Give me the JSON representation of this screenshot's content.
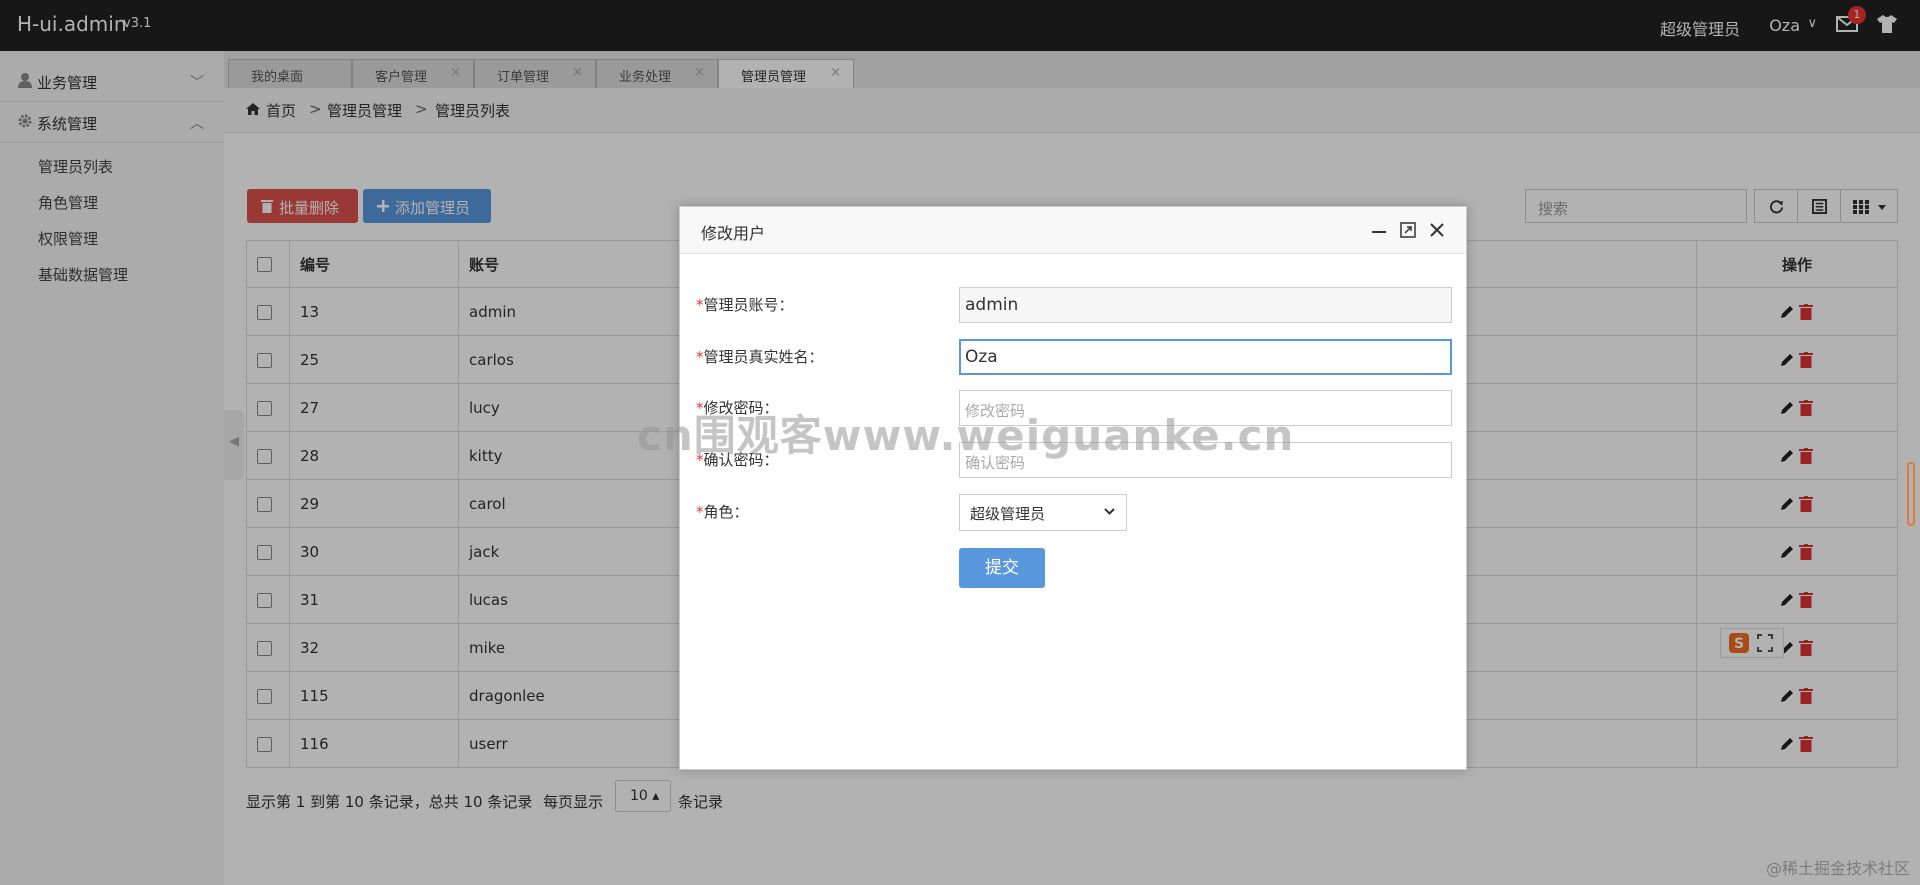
{
  "app": {
    "title": "H-ui.admin",
    "version": "v3.1"
  },
  "header": {
    "role": "超级管理员",
    "user": "Oza",
    "chevron": "∨",
    "mail_badge": "1",
    "icons": [
      "mail-icon",
      "shirt-icon"
    ]
  },
  "sidebar": {
    "groups": [
      {
        "label": "业务管理",
        "icon": "user-icon",
        "expanded": false
      },
      {
        "label": "系统管理",
        "icon": "gear-icon",
        "expanded": true
      }
    ],
    "items": [
      "管理员列表",
      "角色管理",
      "权限管理",
      "基础数据管理"
    ]
  },
  "tabs": [
    {
      "label": "我的桌面",
      "closable": false
    },
    {
      "label": "客户管理",
      "closable": true
    },
    {
      "label": "订单管理",
      "closable": true
    },
    {
      "label": "业务处理",
      "closable": true
    },
    {
      "label": "管理员管理",
      "closable": true,
      "active": true
    }
  ],
  "breadcrumb": [
    "首页",
    "管理员管理",
    "管理员列表"
  ],
  "breadcrumb_sep": ">",
  "toolbar": {
    "batch_delete": "批量删除",
    "add_admin": "添加管理员",
    "search_placeholder": "搜索"
  },
  "table": {
    "headers": {
      "id": "编号",
      "account": "账号",
      "actions": "操作"
    },
    "rows": [
      {
        "id": "13",
        "account": "admin"
      },
      {
        "id": "25",
        "account": "carlos"
      },
      {
        "id": "27",
        "account": "lucy"
      },
      {
        "id": "28",
        "account": "kitty"
      },
      {
        "id": "29",
        "account": "carol"
      },
      {
        "id": "30",
        "account": "jack"
      },
      {
        "id": "31",
        "account": "lucas"
      },
      {
        "id": "32",
        "account": "mike"
      },
      {
        "id": "115",
        "account": "dragonlee"
      },
      {
        "id": "116",
        "account": "userr"
      }
    ]
  },
  "pagination": {
    "summary": "显示第 1 到第 10 条记录，总共 10 条记录",
    "per_page_prefix": "每页显示",
    "page_size": "10 ▴",
    "per_page_suffix": "条记录"
  },
  "modal": {
    "title": "修改用户",
    "fields": {
      "account_label": "管理员账号：",
      "account_value": "admin",
      "realname_label": "管理员真实姓名：",
      "realname_value": "Oza",
      "password_label": "修改密码：",
      "password_placeholder": "修改密码",
      "confirm_label": "确认密码：",
      "confirm_placeholder": "确认密码",
      "role_label": "角色：",
      "role_value": "超级管理员"
    },
    "required_mark": "*",
    "submit": "提交"
  },
  "watermark": "cn围观客www.weiguanke.cn",
  "corner_watermark": "@稀土掘金技术社区",
  "colors": {
    "header_bg": "#222222",
    "primary": "#5a98de",
    "danger": "#dd514c",
    "required": "#ee3333"
  }
}
